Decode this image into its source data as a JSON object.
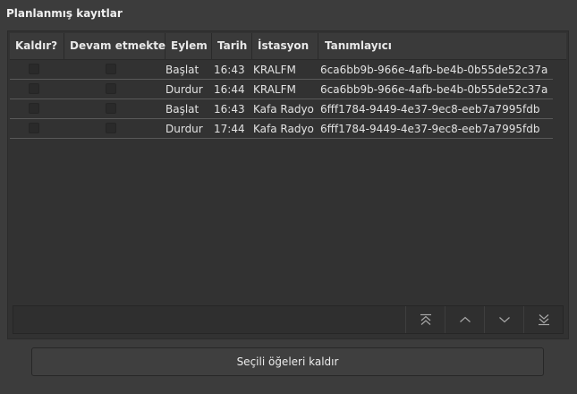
{
  "window": {
    "title": "Planlanmış kayıtlar"
  },
  "table": {
    "headers": {
      "remove": "Kaldır?",
      "continue": "Devam etmekte",
      "action": "Eylem",
      "date": "Tarih",
      "station": "İstasyon",
      "identifier": "Tanımlayıcı"
    },
    "rows": [
      {
        "remove": false,
        "continue": false,
        "action": "Başlat",
        "date": "16:43",
        "station": "KRALFM",
        "identifier": "6ca6bb9b-966e-4afb-be4b-0b55de52c37a"
      },
      {
        "remove": false,
        "continue": false,
        "action": "Durdur",
        "date": "16:44",
        "station": "KRALFM",
        "identifier": "6ca6bb9b-966e-4afb-be4b-0b55de52c37a"
      },
      {
        "remove": false,
        "continue": false,
        "action": "Başlat",
        "date": "16:43",
        "station": "Kafa Radyo",
        "identifier": "6fff1784-9449-4e37-9ec8-eeb7a7995fdb"
      },
      {
        "remove": false,
        "continue": false,
        "action": "Durdur",
        "date": "17:44",
        "station": "Kafa Radyo",
        "identifier": "6fff1784-9449-4e37-9ec8-eeb7a7995fdb"
      }
    ]
  },
  "toolbar": {
    "buttons": [
      "move-top-icon",
      "move-up-icon",
      "move-down-icon",
      "move-bottom-icon"
    ]
  },
  "actions": {
    "remove_selected_label": "Seçili öğeleri kaldır"
  }
}
